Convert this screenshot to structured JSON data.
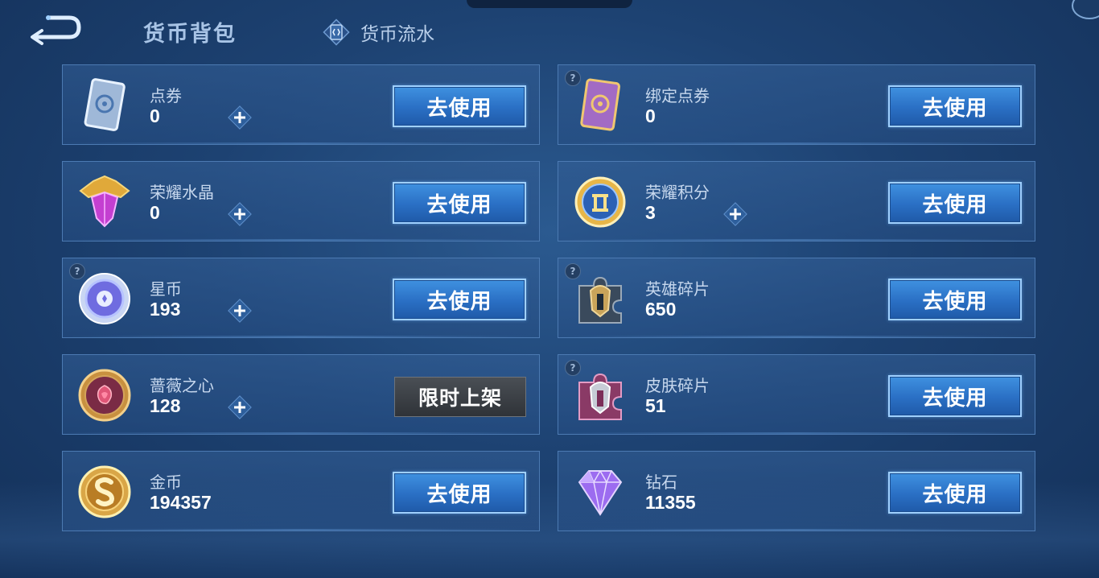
{
  "header": {
    "title": "货币背包",
    "ledger_tab_label": "货币流水"
  },
  "items": [
    {
      "name": "点券",
      "value": "0",
      "action": "去使用",
      "icon": "voucher-card-icon",
      "has_plus": true,
      "has_help": false
    },
    {
      "name": "绑定点券",
      "value": "0",
      "action": "去使用",
      "icon": "bound-voucher-card-icon",
      "has_plus": false,
      "has_help": true
    },
    {
      "name": "荣耀水晶",
      "value": "0",
      "action": "去使用",
      "icon": "glory-crystal-icon",
      "has_plus": true,
      "has_help": false
    },
    {
      "name": "荣耀积分",
      "value": "3",
      "action": "去使用",
      "icon": "glory-points-icon",
      "has_plus": true,
      "has_help": false
    },
    {
      "name": "星币",
      "value": "193",
      "action": "去使用",
      "icon": "star-coin-icon",
      "has_plus": true,
      "has_help": true
    },
    {
      "name": "英雄碎片",
      "value": "650",
      "action": "去使用",
      "icon": "hero-shard-icon",
      "has_plus": false,
      "has_help": true
    },
    {
      "name": "蔷薇之心",
      "value": "128",
      "action": "限时上架",
      "icon": "rose-heart-icon",
      "has_plus": true,
      "has_help": false
    },
    {
      "name": "皮肤碎片",
      "value": "51",
      "action": "去使用",
      "icon": "skin-shard-icon",
      "has_plus": false,
      "has_help": true
    },
    {
      "name": "金币",
      "value": "194357",
      "action": "去使用",
      "icon": "gold-coin-icon",
      "has_plus": false,
      "has_help": false
    },
    {
      "name": "钻石",
      "value": "11355",
      "action": "去使用",
      "icon": "diamond-icon",
      "has_plus": false,
      "has_help": false
    }
  ],
  "colors": {
    "accent_button": "#2a6fc4",
    "card_border": "#4c7ab2",
    "background": "#1d4272"
  }
}
